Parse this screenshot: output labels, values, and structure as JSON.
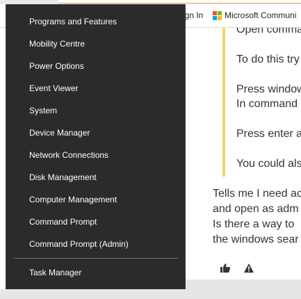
{
  "bookmarks": {
    "signin_label": "ign In",
    "microsoft_label": "Microsoft Communi"
  },
  "article": {
    "quote_lines": [
      "Open comma",
      "To do this try",
      "Press window",
      "In command",
      "Press enter a",
      "You could als"
    ],
    "para_lines": [
      "Tells me I need ac",
      "and open as adm",
      "Is there a way to",
      "the windows sear"
    ]
  },
  "reactions": {
    "like_icon": "thumbs-up-icon",
    "report_icon": "warning-icon"
  },
  "menu": {
    "items": [
      "Programs and Features",
      "Mobility Centre",
      "Power Options",
      "Event Viewer",
      "System",
      "Device Manager",
      "Network Connections",
      "Disk Management",
      "Computer Management",
      "Command Prompt",
      "Command Prompt (Admin)"
    ],
    "task_manager": "Task Manager"
  },
  "colors": {
    "menu_bg": "#2b2b2b",
    "quote_bar": "#f5d26a",
    "ms_red": "#f25022",
    "ms_green": "#7fba00",
    "ms_blue": "#00a4ef",
    "ms_yellow": "#ffb900"
  }
}
